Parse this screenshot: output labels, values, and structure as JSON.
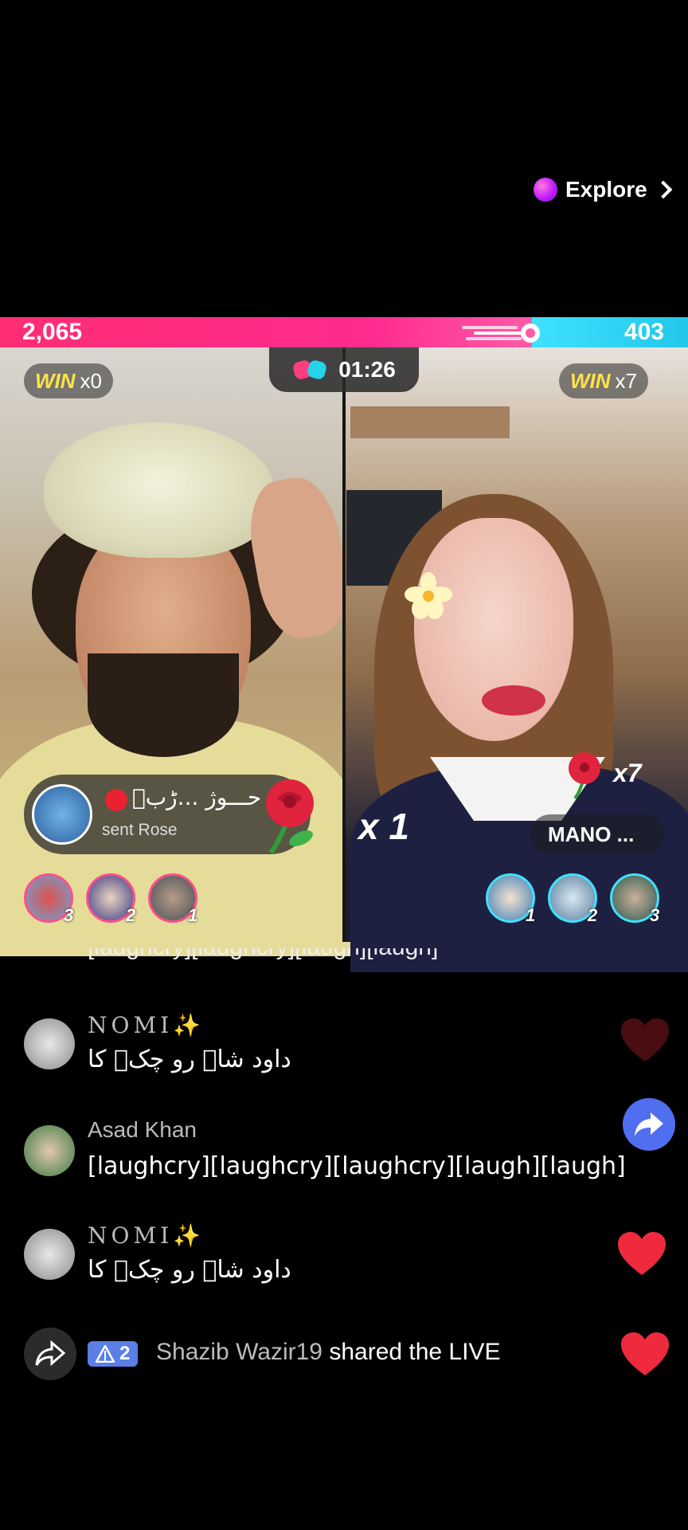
{
  "explore": {
    "label": "Explore"
  },
  "battle": {
    "left_score": "2,065",
    "right_score": "403",
    "timer": "01:26",
    "left_win_label": "WIN",
    "left_win_count": "x0",
    "right_win_label": "WIN",
    "right_win_count": "x7",
    "colors": {
      "left": "#ff2d74",
      "right": "#3fe1ff",
      "win": "#ffe24a"
    }
  },
  "gift_toast": {
    "sender": "حـــوژ ...ڑبؔ",
    "action": "sent Rose",
    "gift_icon": "rose-icon"
  },
  "multiplier": "x 1",
  "right_gift": {
    "count": "x7",
    "gift_icon": "rose-icon"
  },
  "right_host": {
    "name": "MANO ..."
  },
  "left_gifters": [
    {
      "rank": "3"
    },
    {
      "rank": "2"
    },
    {
      "rank": "1"
    }
  ],
  "right_gifters": [
    {
      "rank": "1"
    },
    {
      "rank": "2"
    },
    {
      "rank": "3"
    }
  ],
  "comments": {
    "partial_top": "[laughcry][laughcry][laugh][laugh]",
    "items": [
      {
        "user": "NOMI✨",
        "text": "داود شاہ رو چکؔ کا"
      },
      {
        "user": "Asad Khan",
        "text": "[laughcry][laughcry][laughcry][laugh][laugh]"
      },
      {
        "user": "NOMI✨",
        "text": "داود شاہ رو چکؔ کا"
      }
    ],
    "share_event": {
      "level": "2",
      "user": "Shazib Wazir19",
      "text": "shared the LIVE"
    }
  }
}
